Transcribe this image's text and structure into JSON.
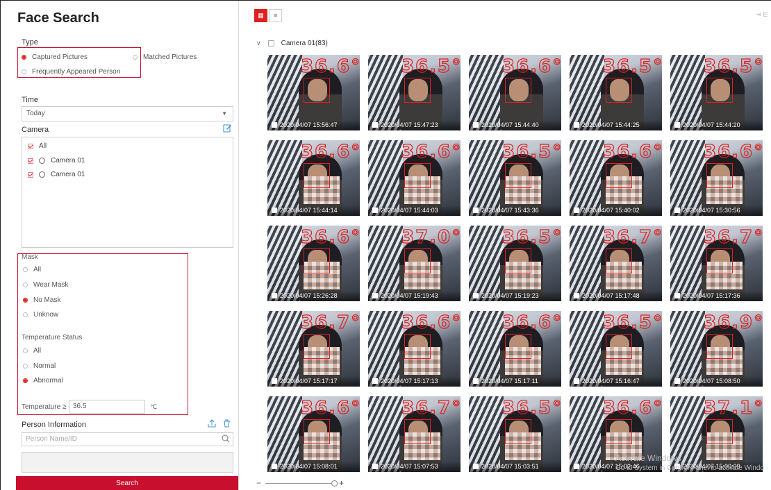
{
  "panel": {
    "title": "Face Search",
    "type_label": "Type",
    "type_options": [
      "Captured Pictures",
      "Matched Pictures",
      "Frequently Appeared Person"
    ],
    "time_label": "Time",
    "time_value": "Today",
    "camera_label": "Camera",
    "cameras": [
      "All",
      "Camera 01",
      "Camera 01"
    ],
    "mask_label": "Mask",
    "mask_options": [
      "All",
      "Wear Mask",
      "No Mask",
      "Unknow"
    ],
    "mask_selected": "No Mask",
    "temp_status_label": "Temperature Status",
    "temp_status_options": [
      "All",
      "Normal",
      "Abnormal"
    ],
    "temp_status_selected": "Abnormal",
    "temperature_label": "Temperature ≥",
    "temperature_value": "36.5",
    "temperature_unit": "℃",
    "person_info_label": "Person Information",
    "person_placeholder": "Person Name/ID",
    "search_label": "Search"
  },
  "results": {
    "group_label": "Camera 01(83)",
    "export_label": "⇥ E",
    "items": [
      {
        "temp": "36.6℃",
        "time": "2020/04/07 15:56:47"
      },
      {
        "temp": "36.5℃",
        "time": "2020/04/07 15:47:23"
      },
      {
        "temp": "36.6℃",
        "time": "2020/04/07 15:44:40"
      },
      {
        "temp": "36.5℃",
        "time": "2020/04/07 15:44:25"
      },
      {
        "temp": "36.5℃",
        "time": "2020/04/07 15:44:20"
      },
      {
        "temp": "36.6℃",
        "time": "2020/04/07 15:44:14"
      },
      {
        "temp": "36.6℃",
        "time": "2020/04/07 15:44:03"
      },
      {
        "temp": "36.5℃",
        "time": "2020/04/07 15:43:36"
      },
      {
        "temp": "36.6℃",
        "time": "2020/04/07 15:40:02"
      },
      {
        "temp": "36.6℃",
        "time": "2020/04/07 15:30:56"
      },
      {
        "temp": "36.6℃",
        "time": "2020/04/07 15:26:28"
      },
      {
        "temp": "37.0℃",
        "time": "2020/04/07 15:19:43"
      },
      {
        "temp": "36.5℃",
        "time": "2020/04/07 15:19:23"
      },
      {
        "temp": "36.7℃",
        "time": "2020/04/07 15:17:48"
      },
      {
        "temp": "36.7℃",
        "time": "2020/04/07 15:17:36"
      },
      {
        "temp": "36.7℃",
        "time": "2020/04/07 15:17:17"
      },
      {
        "temp": "36.6℃",
        "time": "2020/04/07 15:17:13"
      },
      {
        "temp": "36.6℃",
        "time": "2020/04/07 15:17:11"
      },
      {
        "temp": "36.5℃",
        "time": "2020/04/07 15:16:47"
      },
      {
        "temp": "36.9℃",
        "time": "2020/04/07 15:08:50"
      },
      {
        "temp": "36.6℃",
        "time": "2020/04/07 15:08:01"
      },
      {
        "temp": "36.7℃",
        "time": "2020/04/07 15:07:53"
      },
      {
        "temp": "36.5℃",
        "time": "2020/04/07 15:03:51"
      },
      {
        "temp": "36.6℃",
        "time": "2020/04/07 15:02:46"
      },
      {
        "temp": "37.1℃",
        "time": "2020/04/07 15:00:09"
      }
    ]
  },
  "watermark": {
    "line1": "Activate Windows",
    "line2": "Go to System in Control Panel to activate Windo"
  },
  "colors": {
    "accent": "#e02020",
    "button": "#c8102e"
  },
  "icons": [
    "edit-icon",
    "upload-icon",
    "trash-icon",
    "search-icon",
    "grid-view-icon",
    "list-view-icon",
    "chevron-down-icon",
    "collapse-icon"
  ]
}
